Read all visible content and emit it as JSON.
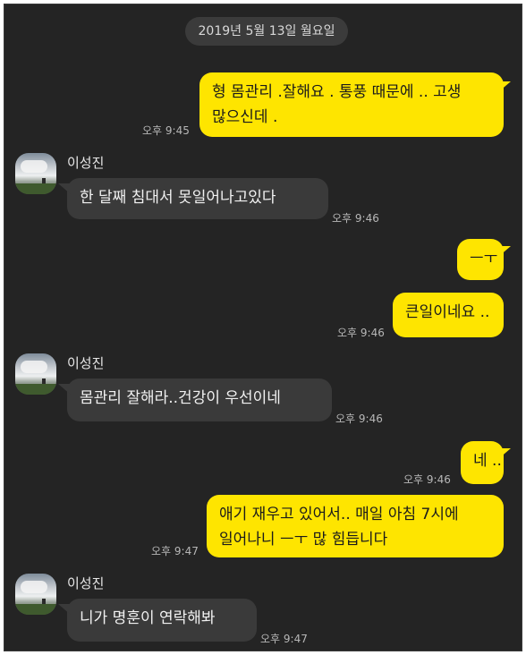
{
  "date_divider": "2019년 5월 13일 월요일",
  "contact_name": "이성진",
  "messages": [
    {
      "side": "me",
      "lines": [
        "형 몸관리 .잘해요 . 통풍 때문에 .. 고생",
        "많으신데 ."
      ],
      "time": "오후 9:45"
    },
    {
      "side": "other",
      "lines": [
        "한 달째 침대서 못일어나고있다"
      ],
      "time": "오후 9:46"
    },
    {
      "side": "me",
      "lines": [
        "ㅡㅜ"
      ],
      "time": ""
    },
    {
      "side": "me",
      "lines": [
        "큰일이네요 .."
      ],
      "time": "오후 9:46"
    },
    {
      "side": "other",
      "lines": [
        "몸관리 잘해라..건강이 우선이네"
      ],
      "time": "오후 9:46"
    },
    {
      "side": "me",
      "lines": [
        "네 .."
      ],
      "time": "오후 9:46"
    },
    {
      "side": "me",
      "lines": [
        "애기 재우고 있어서.. 매일 아침 7시에",
        "일어나니 ㅡㅜ 많 힘듭니다"
      ],
      "time": "오후 9:47"
    },
    {
      "side": "other",
      "lines": [
        "니가 명훈이 연락해봐"
      ],
      "time": "오후 9:47"
    }
  ]
}
